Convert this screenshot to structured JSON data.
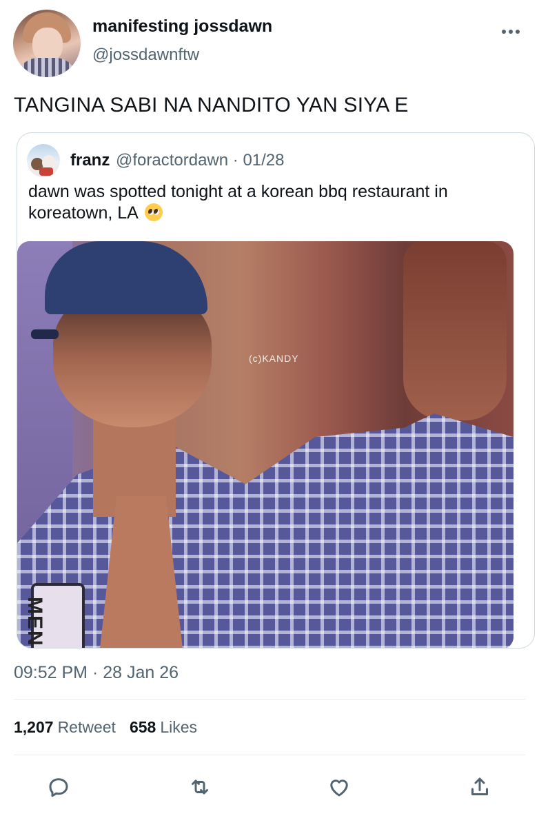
{
  "author": {
    "display_name": "manifesting jossdawn",
    "handle": "@jossdawnftw"
  },
  "tweet_text": "TANGINA SABI NA NANDITO YAN SIYA E",
  "quoted_tweet": {
    "display_name": "franz",
    "handle": "@foractordawn",
    "date": "01/28",
    "text": "dawn was spotted tonight at a korean bbq restaurant in koreatown, LA",
    "emoji": "pleading-face",
    "photo": {
      "watermark": "(c)KANDY",
      "sign_text": "MEN"
    }
  },
  "timestamp": "09:52 PM · 28 Jan 26",
  "stats": {
    "retweets_count": "1,207",
    "retweets_label": "Retweet",
    "likes_count": "658",
    "likes_label": "Likes"
  },
  "actions": [
    "reply-icon",
    "retweet-icon",
    "like-icon",
    "share-icon"
  ],
  "colors": {
    "secondary_text": "#536471",
    "border": "#cfd9de",
    "divider": "#e6ecf0"
  }
}
